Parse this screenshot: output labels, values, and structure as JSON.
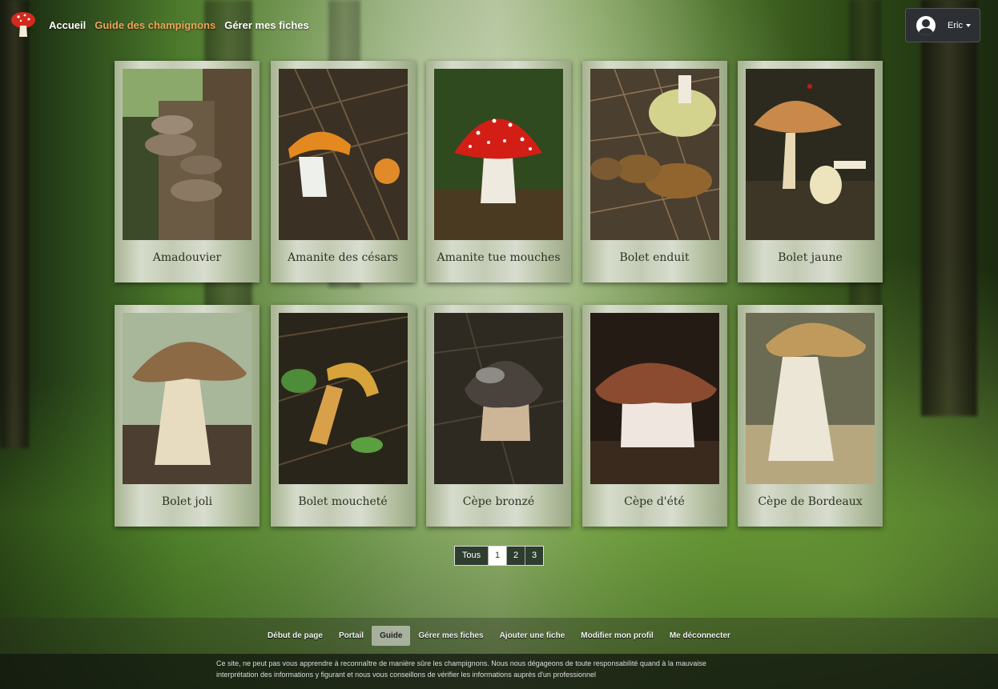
{
  "navbar": {
    "logo_icon": "amanita-mushroom-logo",
    "links": [
      {
        "label": "Accueil",
        "active": false
      },
      {
        "label": "Guide des champignons",
        "active": true
      },
      {
        "label": "Gérer mes fiches",
        "active": false
      }
    ],
    "user": {
      "name": "Eric",
      "icon": "user-circle-icon"
    }
  },
  "colors": {
    "accent": "#f0a25a",
    "pagination_bg": "#2d3d2e"
  },
  "cards": [
    {
      "name": "Amadouvier"
    },
    {
      "name": "Amanite des césars"
    },
    {
      "name": "Amanite tue mouches"
    },
    {
      "name": "Bolet enduit"
    },
    {
      "name": "Bolet jaune"
    },
    {
      "name": "Bolet joli"
    },
    {
      "name": "Bolet moucheté"
    },
    {
      "name": "Cèpe bronzé"
    },
    {
      "name": "Cèpe d'été"
    },
    {
      "name": "Cèpe de Bordeaux"
    }
  ],
  "pagination": {
    "all_label": "Tous",
    "pages": [
      "1",
      "2",
      "3"
    ],
    "current": "1"
  },
  "footer": {
    "links": [
      "Début de page",
      "Portail",
      "Guide",
      "Gérer mes fiches",
      "Ajouter une fiche",
      "Modifier mon profil",
      "Me déconnecter"
    ],
    "active": "Guide",
    "disclaimer": "Ce site, ne peut pas vous apprendre à reconnaître de manière sûre les champignons. Nous nous dégageons de toute responsabilité quand à la mauvaise interprétation des informations y figurant et nous vous conseillons de vérifier les informations auprès d'un professionnel"
  }
}
